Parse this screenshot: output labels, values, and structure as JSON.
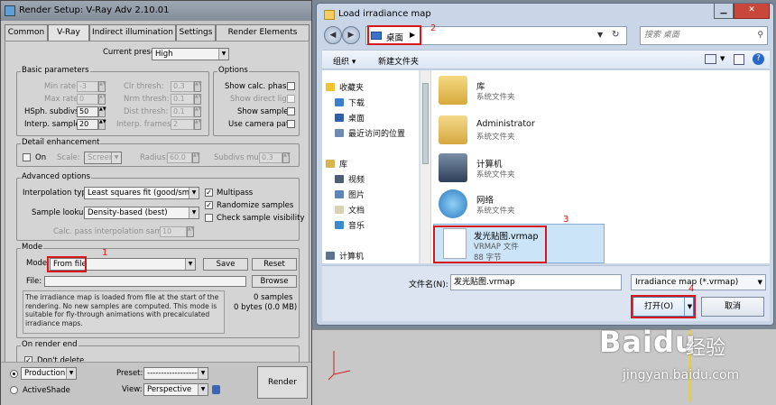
{
  "render_setup": {
    "title": "Render Setup: V-Ray Adv 2.10.01",
    "tabs": [
      "Common",
      "V-Ray",
      "Indirect illumination",
      "Settings",
      "Render Elements"
    ],
    "current_preset_label": "Current preset:",
    "current_preset_value": "High",
    "basic_parameters": {
      "title": "Basic parameters",
      "min_rate_label": "Min rate:",
      "min_rate": "-3",
      "max_rate_label": "Max rate:",
      "max_rate": "0",
      "hsph_label": "HSph. subdivs:",
      "hsph": "50",
      "interp_label": "Interp. samples:",
      "interp": "20",
      "clr_thresh_label": "Clr thresh:",
      "clr_thresh": "0.3",
      "nrm_thresh_label": "Nrm thresh:",
      "nrm_thresh": "0.1",
      "dist_thresh_label": "Dist thresh:",
      "dist_thresh": "0.1",
      "interp_frames_label": "Interp. frames:",
      "interp_frames": "2"
    },
    "options": {
      "title": "Options",
      "show_calc": "Show calc. phase",
      "show_direct": "Show direct light",
      "show_samples": "Show samples",
      "use_camera": "Use camera path"
    },
    "detail": {
      "title": "Detail enhancement",
      "on": "On",
      "scale_label": "Scale:",
      "scale_value": "Screen",
      "radius_label": "Radius:",
      "radius": "60.0",
      "subdivs_label": "Subdivs mult.",
      "subdivs": "0.3"
    },
    "advanced": {
      "title": "Advanced options",
      "interp_type_label": "Interpolation type:",
      "interp_type": "Least squares fit (good/smooth",
      "multipass": "Multipass",
      "randomize": "Randomize samples",
      "check_visibility": "Check sample visibility",
      "sample_lookup_label": "Sample lookup:",
      "sample_lookup": "Density-based (best)",
      "calc_pass_label": "Calc. pass interpolation samples:",
      "calc_pass": "10"
    },
    "mode": {
      "title": "Mode",
      "mode_label": "Mode:",
      "mode_value": "From file",
      "save": "Save",
      "reset": "Reset",
      "file_label": "File:",
      "browse": "Browse",
      "info": "The irradiance map is loaded from file at the start of the rendering. No new samples are computed. This mode is suitable for fly-through animations with precalculated irradiance maps.",
      "samples": "0 samples",
      "bytes": "0 bytes (0.0 MB)"
    },
    "on_render_end": {
      "title": "On render end",
      "dont_delete": "Don't delete"
    },
    "bottom": {
      "production": "Production",
      "activeshade": "ActiveShade",
      "preset_label": "Preset:",
      "preset_value": "-------------------",
      "view_label": "View:",
      "view_value": "Perspective",
      "render": "Render"
    }
  },
  "file_dialog": {
    "title": "Load irradiance map",
    "address": "桌面",
    "search_placeholder": "搜索 桌面",
    "organize": "组织 ▾",
    "new_folder": "新建文件夹",
    "nav": {
      "favorites": "收藏夹",
      "download": "下载",
      "desktop": "桌面",
      "recent": "最近访问的位置",
      "libraries": "库",
      "videos": "视频",
      "pictures": "图片",
      "documents": "文档",
      "music": "音乐",
      "computer": "计算机"
    },
    "files": [
      {
        "name": "库",
        "type": "系统文件夹",
        "size": ""
      },
      {
        "name": "Administrator",
        "type": "系统文件夹",
        "size": ""
      },
      {
        "name": "计算机",
        "type": "系统文件夹",
        "size": ""
      },
      {
        "name": "网络",
        "type": "系统文件夹",
        "size": ""
      },
      {
        "name": "发光贴图.vrmap",
        "type": "VRMAP 文件",
        "size": "88 字节"
      }
    ],
    "filename_label": "文件名(N):",
    "filename": "发光贴图.vrmap",
    "filter": "Irradiance map (*.vrmap)",
    "open": "打开(O)",
    "cancel": "取消"
  },
  "annotations": [
    "1",
    "2",
    "3",
    "4"
  ],
  "watermark": {
    "brand": "Baidu",
    "brand_cn": "经验",
    "url": "jingyan.baidu.com"
  }
}
